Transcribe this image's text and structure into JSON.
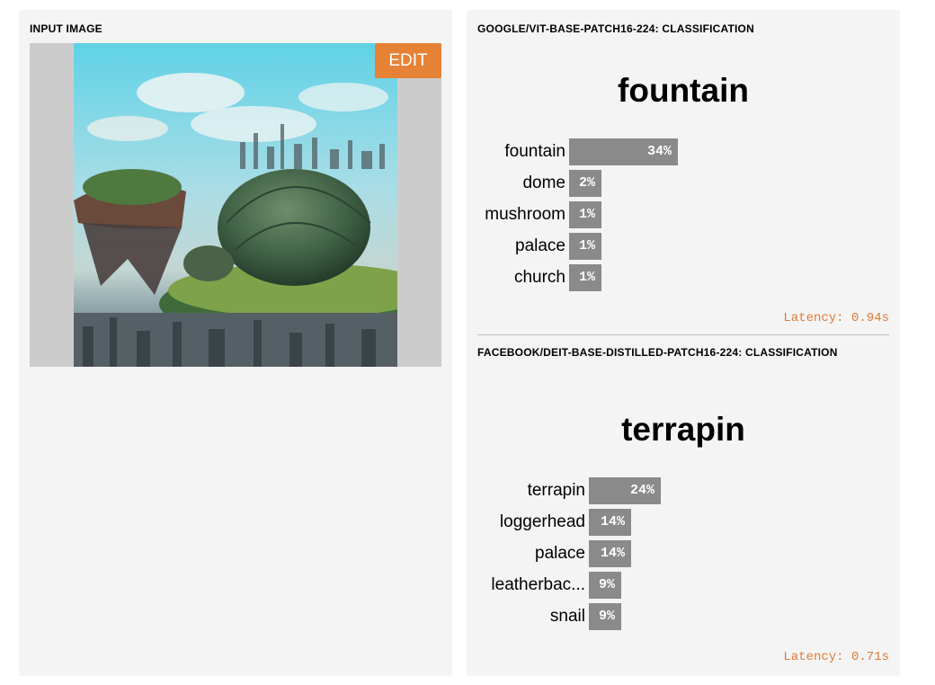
{
  "input_panel": {
    "title": "INPUT IMAGE",
    "edit_label": "EDIT",
    "edit_color": "#e68235"
  },
  "models": [
    {
      "title": "GOOGLE/VIT-BASE-PATCH16-224: CLASSIFICATION",
      "top_label": "fountain",
      "predictions": [
        {
          "label": "fountain",
          "value": "34%",
          "fraction": 0.34
        },
        {
          "label": "dome",
          "value": "2%",
          "fraction": 0.02
        },
        {
          "label": "mushroom",
          "value": "1%",
          "fraction": 0.01
        },
        {
          "label": "palace",
          "value": "1%",
          "fraction": 0.01
        },
        {
          "label": "church",
          "value": "1%",
          "fraction": 0.01
        }
      ],
      "latency": "Latency: 0.94s"
    },
    {
      "title": "FACEBOOK/DEIT-BASE-DISTILLED-PATCH16-224: CLASSIFICATION",
      "top_label": "terrapin",
      "predictions": [
        {
          "label": "terrapin",
          "value": "24%",
          "fraction": 0.24
        },
        {
          "label": "loggerhead",
          "value": "14%",
          "fraction": 0.14
        },
        {
          "label": "palace",
          "value": "14%",
          "fraction": 0.14
        },
        {
          "label": "leatherbac...",
          "value": "9%",
          "fraction": 0.09
        },
        {
          "label": "snail",
          "value": "9%",
          "fraction": 0.09
        }
      ],
      "latency": "Latency: 0.71s"
    }
  ],
  "colors": {
    "bar": "#8a8a8a",
    "latency": "#e07b36",
    "panel": "#f4f4f4"
  }
}
